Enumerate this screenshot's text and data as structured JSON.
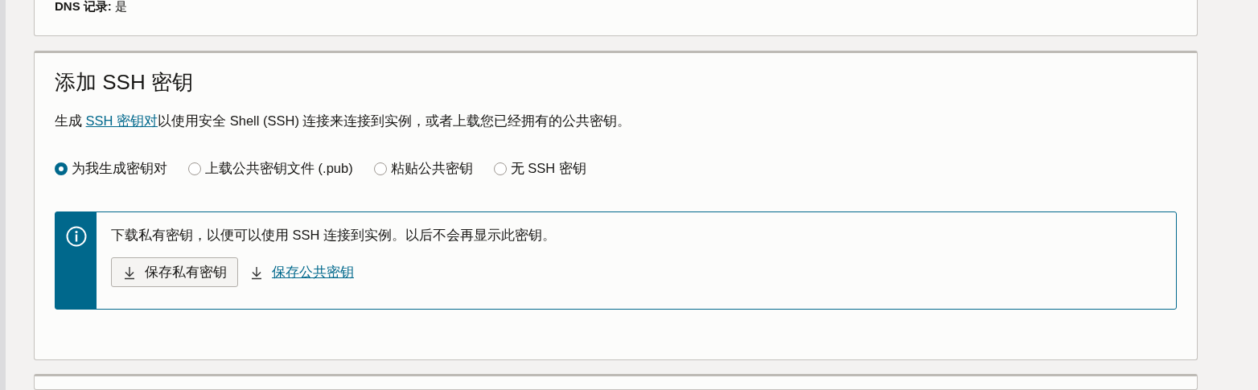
{
  "dns_record": {
    "label": "DNS 记录:",
    "value": "是"
  },
  "ssh_section": {
    "title": "添加 SSH 密钥",
    "description": {
      "before": "生成 ",
      "link": "SSH 密钥对",
      "after": "以使用安全 Shell (SSH) 连接来连接到实例，或者上载您已经拥有的公共密钥。"
    },
    "options": [
      {
        "label": "为我生成密钥对",
        "selected": true
      },
      {
        "label": "上载公共密钥文件 (.pub)",
        "selected": false
      },
      {
        "label": "粘贴公共密钥",
        "selected": false
      },
      {
        "label": "无 SSH 密钥",
        "selected": false
      }
    ],
    "notice": {
      "message": "下载私有密钥，以便可以使用 SSH 连接到实例。以后不会再显示此密钥。",
      "actions": [
        {
          "kind": "button",
          "label": "保存私有密钥"
        },
        {
          "kind": "link",
          "label": "保存公共密钥"
        }
      ]
    }
  }
}
